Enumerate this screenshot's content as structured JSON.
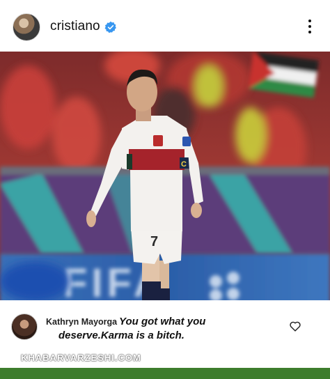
{
  "post": {
    "username": "cristiano",
    "verified_icon": "verified-badge-icon",
    "more_icon": "more-vertical-icon"
  },
  "photo": {
    "jersey_number": "7",
    "captain_band": "C",
    "background_banner": "FIFA"
  },
  "comment": {
    "author": "Kathryn Mayorga",
    "text_line1": "You got what you",
    "text_line2": "deserve.Karma is a bitch.",
    "like_icon": "heart-icon"
  },
  "watermark": {
    "text": "KHABARVARZESHI.COM"
  },
  "colors": {
    "verified": "#3897f0",
    "jersey_white": "#f3f1ee",
    "jersey_red": "#a5232b",
    "stands_red": "#b8322e",
    "banner_blue": "#1f5fb3",
    "grass": "#3d7d2c"
  }
}
